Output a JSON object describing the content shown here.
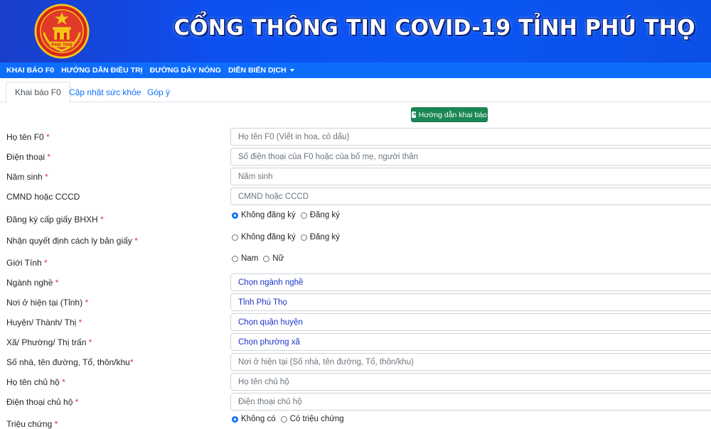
{
  "header": {
    "title": "CỔNG THÔNG TIN COVID-19 TỈNH PHÚ THỌ",
    "logo_text": "PHÚ THỌ",
    "colors": {
      "banner": "#0d4ff0",
      "nav": "#0d6efd",
      "accent_green": "#198754",
      "required": "#dc3545"
    }
  },
  "nav": {
    "items": [
      "KHAI BÁO F0",
      "HƯỚNG DẪN ĐIỀU TRỊ",
      "ĐƯỜNG DÂY NÓNG",
      "DIỄN BIẾN DỊCH"
    ]
  },
  "tabs": [
    "Khai báo F0",
    "Cập nhật sức khỏe",
    "Góp ý"
  ],
  "guide_button": "Hướng dẫn khai báo",
  "form": {
    "full_name": {
      "label": "Họ tên F0",
      "placeholder": "Họ tên F0 (Viết in hoa, có dấu)"
    },
    "phone": {
      "label": "Điện thoại",
      "placeholder": "Số điện thoại của F0 hoặc của bố mẹ, người thân"
    },
    "birth_year": {
      "label": "Năm sinh",
      "placeholder": "Năm sinh"
    },
    "id_card": {
      "label": "CMND hoặc CCCD",
      "placeholder": "CMND hoặc CCCD"
    },
    "bhxh": {
      "label": "Đăng ký cấp giấy BHXH",
      "options": [
        "Không đăng ký",
        "Đăng ký"
      ],
      "selected": "Không đăng ký"
    },
    "quarantine": {
      "label": "Nhận quyết định cách ly bản giấy",
      "options": [
        "Không đăng ký",
        "Đăng ký"
      ],
      "selected": ""
    },
    "gender": {
      "label": "Giới Tính",
      "options": [
        "Nam",
        "Nữ"
      ],
      "selected": ""
    },
    "occupation": {
      "label": "Ngành nghề",
      "value": "Chọn ngành nghề"
    },
    "province": {
      "label": "Nơi ở hiện tại (Tỉnh)",
      "value": "Tỉnh Phú Thọ"
    },
    "district": {
      "label": "Huyện/ Thành/ Thị",
      "value": "Chọn quận huyện"
    },
    "ward": {
      "label": "Xã/ Phường/ Thị trấn",
      "value": "Chọn phường xã"
    },
    "address": {
      "label": "Số nhà, tên đường, Tổ, thôn/khu",
      "placeholder": "Nơi ở hiện tại (Số nhà, tên đường, Tổ, thôn/khu)"
    },
    "household_head": {
      "label": "Họ tên chủ hộ",
      "placeholder": "Họ tên chủ hộ"
    },
    "household_phone": {
      "label": "Điện thoại chủ hộ",
      "placeholder": "Điện thoại chủ hộ"
    },
    "symptoms": {
      "label": "Triệu chứng",
      "options": [
        "Không có",
        "Có triệu chứng"
      ],
      "selected": "Không có"
    },
    "required_mark": "*"
  }
}
